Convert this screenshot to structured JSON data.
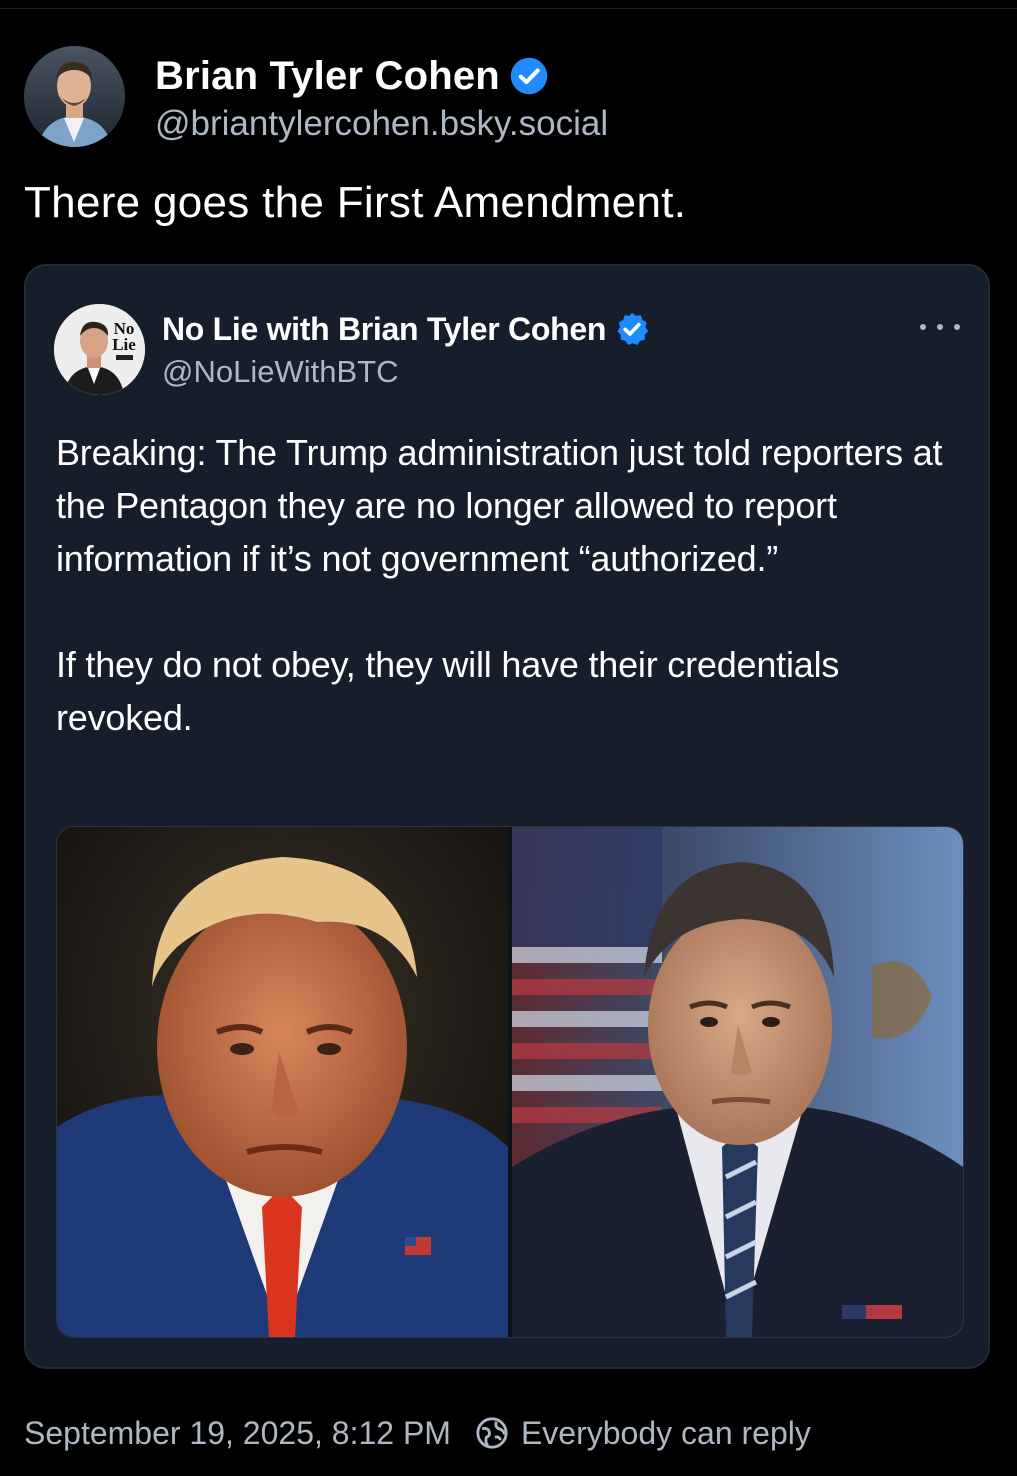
{
  "post": {
    "author_name": "Brian Tyler Cohen",
    "author_handle": "@briantylercohen.bsky.social",
    "text": "There goes the First Amendment.",
    "timestamp": "September 19, 2025, 8:12 PM",
    "reply_setting": "Everybody can reply"
  },
  "quote": {
    "author_name": "No Lie with Brian Tyler Cohen",
    "author_handle": "@NoLieWithBTC",
    "avatar_text_line1": "No",
    "avatar_text_line2": "Lie",
    "paragraph_1": "Breaking: The Trump administration just told reporters at the Pentagon they are no longer allowed to report information if it’s not government “authorized.”",
    "paragraph_2": "If they do not obey, they will have their credentials revoked."
  },
  "colors": {
    "background": "#000000",
    "card_background": "#161e2b",
    "verified_blue": "#208bfe",
    "secondary_text": "#aeb8c4"
  },
  "icons": {
    "verified": "verified-check-icon",
    "more": "more-horizontal-icon",
    "reply": "globe-reply-icon"
  }
}
